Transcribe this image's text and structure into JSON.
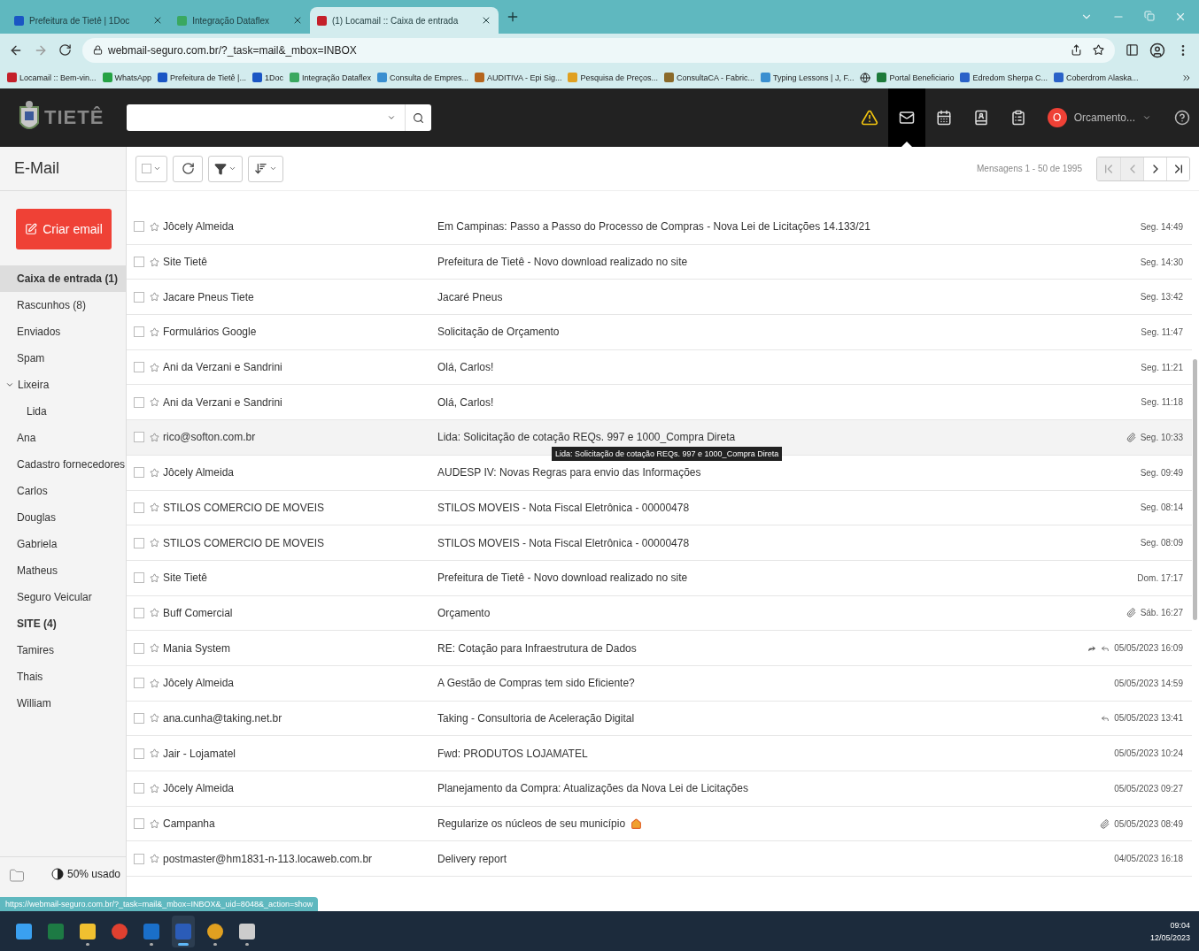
{
  "browser": {
    "tabs": [
      {
        "title": "Prefeitura de Tietê | 1Doc",
        "color": "#1a56c4",
        "selected": false
      },
      {
        "title": "Integração Dataflex",
        "color": "#3aa860",
        "selected": false
      },
      {
        "title": "(1) Locamail :: Caixa de entrada",
        "color": "#c4202a",
        "selected": true
      }
    ],
    "url": "webmail-seguro.com.br/?_task=mail&_mbox=INBOX",
    "bookmarks": [
      {
        "label": "Locamail :: Bem-vin...",
        "color": "#c4202a"
      },
      {
        "label": "WhatsApp",
        "color": "#25a244"
      },
      {
        "label": "Prefeitura de Tietê |...",
        "color": "#1a56c4"
      },
      {
        "label": "1Doc",
        "color": "#1a56c4"
      },
      {
        "label": "Integração Dataflex",
        "color": "#3aa860"
      },
      {
        "label": "Consulta de Empres...",
        "color": "#3a8fd0"
      },
      {
        "label": "AUDITIVA - Epi Sig...",
        "color": "#b5651d"
      },
      {
        "label": "Pesquisa de Preços...",
        "color": "#e0a020"
      },
      {
        "label": "ConsultaCA - Fabric...",
        "color": "#8a6a2a"
      },
      {
        "label": "Typing Lessons | J, F...",
        "color": "#3a8fd0"
      },
      {
        "label": "Portal Beneficiario",
        "color": "#1d7a3a"
      },
      {
        "label": "Edredom Sherpa C...",
        "color": "#2a62c8"
      },
      {
        "label": "Coberdrom Alaska...",
        "color": "#2a62c8"
      }
    ]
  },
  "app": {
    "logo_text": "TIETÊ",
    "nav": [
      {
        "kind": "alert",
        "selected": false
      },
      {
        "kind": "mail",
        "selected": true
      },
      {
        "kind": "calendar",
        "selected": false
      },
      {
        "kind": "contacts",
        "selected": false
      },
      {
        "kind": "notes",
        "selected": false
      }
    ],
    "account": {
      "initial": "O",
      "name": "Orcamento..."
    }
  },
  "sidebar": {
    "title": "E-Mail",
    "compose": "Criar email",
    "folders": [
      {
        "name": "Caixa de entrada (1)",
        "selected": true,
        "unread": true
      },
      {
        "name": "Rascunhos (8)",
        "selected": false,
        "unread": false
      },
      {
        "name": "Enviados",
        "selected": false,
        "unread": false
      },
      {
        "name": "Spam",
        "selected": false,
        "unread": false
      },
      {
        "name": "Lixeira",
        "selected": false,
        "unread": false,
        "expanded": true,
        "children": [
          {
            "name": "Lida",
            "selected": false,
            "unread": false
          }
        ]
      },
      {
        "name": "Ana",
        "selected": false,
        "unread": false
      },
      {
        "name": "Cadastro fornecedores",
        "selected": false,
        "unread": false
      },
      {
        "name": "Carlos",
        "selected": false,
        "unread": false
      },
      {
        "name": "Douglas",
        "selected": false,
        "unread": false
      },
      {
        "name": "Gabriela",
        "selected": false,
        "unread": false
      },
      {
        "name": "Matheus",
        "selected": false,
        "unread": false
      },
      {
        "name": "Seguro Veicular",
        "selected": false,
        "unread": false
      },
      {
        "name": "SITE (4)",
        "selected": false,
        "unread": true
      },
      {
        "name": "Tamires",
        "selected": false,
        "unread": false
      },
      {
        "name": "Thais",
        "selected": false,
        "unread": false
      },
      {
        "name": "William",
        "selected": false,
        "unread": false
      }
    ],
    "quota": {
      "text": "50% usado",
      "level": 0.5
    }
  },
  "list": {
    "count": "Mensagens 1 - 50 de 1995",
    "pager": [
      {
        "kind": "first",
        "disabled": true
      },
      {
        "kind": "prev",
        "disabled": true
      },
      {
        "kind": "next",
        "disabled": false
      },
      {
        "kind": "last",
        "disabled": false
      }
    ],
    "rows": [
      {
        "sender": "Jôcely Almeida",
        "subject": "Em Campinas: Passo a Passo do Processo de Compras - Nova Lei de Licitações 14.133/21",
        "date": "Seg. 14:49",
        "checked": false,
        "flagged": false,
        "selected": false,
        "attachment": false,
        "forwarded": false,
        "replied": false
      },
      {
        "sender": "Site Tietê",
        "subject": "Prefeitura de Tietê - Novo download realizado no site",
        "date": "Seg. 14:30",
        "checked": false,
        "flagged": false,
        "selected": false,
        "attachment": false,
        "forwarded": false,
        "replied": false
      },
      {
        "sender": "Jacare Pneus Tiete",
        "subject": "Jacaré Pneus",
        "date": "Seg. 13:42",
        "checked": false,
        "flagged": false,
        "selected": false,
        "attachment": false,
        "forwarded": false,
        "replied": false
      },
      {
        "sender": "Formulários Google",
        "subject": "Solicitação de Orçamento",
        "date": "Seg. 11:47",
        "checked": false,
        "flagged": false,
        "selected": false,
        "attachment": false,
        "forwarded": false,
        "replied": false
      },
      {
        "sender": "Ani da Verzani e Sandrini",
        "subject": "Olá, Carlos!",
        "date": "Seg. 11:21",
        "checked": false,
        "flagged": false,
        "selected": false,
        "attachment": false,
        "forwarded": false,
        "replied": false
      },
      {
        "sender": "Ani da Verzani e Sandrini",
        "subject": "Olá, Carlos!",
        "date": "Seg. 11:18",
        "checked": false,
        "flagged": false,
        "selected": false,
        "attachment": false,
        "forwarded": false,
        "replied": false
      },
      {
        "sender": "rico@softon.com.br",
        "subject": "Lida: Solicitação de cotação REQs. 997 e 1000_Compra Direta",
        "date": "Seg. 10:33",
        "checked": false,
        "flagged": false,
        "selected": true,
        "attachment": true,
        "forwarded": false,
        "replied": false,
        "tooltip": "Lida: Solicitação de cotação REQs. 997 e 1000_Compra Direta"
      },
      {
        "sender": "Jôcely Almeida",
        "subject": "AUDESP IV: Novas Regras para envio das Informações",
        "date": "Seg. 09:49",
        "checked": false,
        "flagged": false,
        "selected": false,
        "attachment": false,
        "forwarded": false,
        "replied": false
      },
      {
        "sender": "STILOS COMERCIO DE MOVEIS",
        "subject": "STILOS MOVEIS - Nota Fiscal Eletrônica - 00000478",
        "date": "Seg. 08:14",
        "checked": false,
        "flagged": false,
        "selected": false,
        "attachment": false,
        "forwarded": false,
        "replied": false
      },
      {
        "sender": "STILOS COMERCIO DE MOVEIS",
        "subject": "STILOS MOVEIS - Nota Fiscal Eletrônica - 00000478",
        "date": "Seg. 08:09",
        "checked": false,
        "flagged": false,
        "selected": false,
        "attachment": false,
        "forwarded": false,
        "replied": false
      },
      {
        "sender": "Site Tietê",
        "subject": "Prefeitura de Tietê - Novo download realizado no site",
        "date": "Dom. 17:17",
        "checked": false,
        "flagged": false,
        "selected": false,
        "attachment": false,
        "forwarded": false,
        "replied": false
      },
      {
        "sender": "Buff Comercial",
        "subject": "Orçamento",
        "date": "Sáb. 16:27",
        "checked": false,
        "flagged": false,
        "selected": false,
        "attachment": true,
        "forwarded": false,
        "replied": false
      },
      {
        "sender": "Mania System",
        "subject": "RE: Cotação para Infraestrutura de Dados",
        "date": "05/05/2023 16:09",
        "checked": false,
        "flagged": false,
        "selected": false,
        "attachment": false,
        "forwarded": true,
        "replied": true
      },
      {
        "sender": "Jôcely Almeida",
        "subject": "A Gestão de Compras tem sido Eficiente?",
        "date": "05/05/2023 14:59",
        "checked": false,
        "flagged": false,
        "selected": false,
        "attachment": false,
        "forwarded": false,
        "replied": false
      },
      {
        "sender": "ana.cunha@taking.net.br",
        "subject": "Taking - Consultoria de Aceleração Digital",
        "date": "05/05/2023 13:41",
        "checked": false,
        "flagged": false,
        "selected": false,
        "attachment": false,
        "forwarded": false,
        "replied": true
      },
      {
        "sender": "Jair - Lojamatel",
        "subject": "Fwd: PRODUTOS LOJAMATEL",
        "date": "05/05/2023 10:24",
        "checked": false,
        "flagged": false,
        "selected": false,
        "attachment": false,
        "forwarded": false,
        "replied": false
      },
      {
        "sender": "Jôcely Almeida",
        "subject": "Planejamento da Compra: Atualizações da Nova Lei de Licitações",
        "date": "05/05/2023 09:27",
        "checked": false,
        "flagged": false,
        "selected": false,
        "attachment": false,
        "forwarded": false,
        "replied": false
      },
      {
        "sender": "Campanha",
        "subject": "Regularize os núcleos de seu município",
        "house_icon": true,
        "date": "05/05/2023 08:49",
        "checked": false,
        "flagged": false,
        "selected": false,
        "attachment": true,
        "forwarded": false,
        "replied": false
      },
      {
        "sender": "postmaster@hm1831-n-113.locaweb.com.br",
        "subject": "Delivery report",
        "date": "04/05/2023 16:18",
        "checked": false,
        "flagged": false,
        "selected": false,
        "attachment": false,
        "forwarded": false,
        "replied": false
      }
    ]
  },
  "status_url": "https://webmail-seguro.com.br/?_task=mail&_mbox=INBOX&_uid=8048&_action=show",
  "taskbar": {
    "apps": [
      {
        "kind": "start",
        "running": false,
        "selected": false
      },
      {
        "kind": "excel",
        "running": false,
        "selected": false
      },
      {
        "kind": "explorer",
        "running": true,
        "selected": false
      },
      {
        "kind": "chrome",
        "running": false,
        "selected": false
      },
      {
        "kind": "outlook",
        "running": true,
        "selected": false
      },
      {
        "kind": "word",
        "running": true,
        "selected": true
      },
      {
        "kind": "chrome-profile",
        "running": true,
        "selected": false
      },
      {
        "kind": "remote",
        "running": true,
        "selected": false
      }
    ],
    "time": "09:04",
    "date": "12/05/2023"
  }
}
